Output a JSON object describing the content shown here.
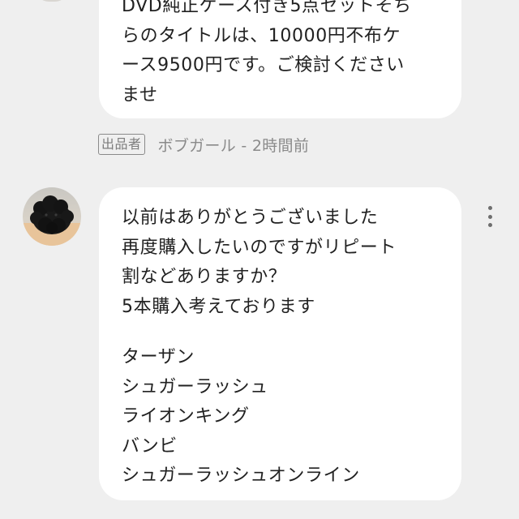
{
  "previous_message": {
    "lines": [
      "DVD純正ケース付き5点セットそち",
      "らのタイトルは、10000円不布ケ",
      "ース9500円です。ご検討ください",
      "ませ"
    ]
  },
  "previous_meta": {
    "badge": "出品者",
    "author_time": "ボブガール - 2時間前"
  },
  "message": {
    "intro_lines": [
      "以前はありがとうございました",
      "再度購入したいのですがリピート",
      "割などありますか？",
      "5本購入考えております"
    ],
    "titles": [
      "ターザン",
      "シュガーラッシュ",
      "ライオンキング",
      "バンビ",
      "シュガーラッシュオンライン"
    ]
  },
  "icons": {
    "menu": "more-vert-icon",
    "avatar": "user-avatar-black-poodle"
  }
}
